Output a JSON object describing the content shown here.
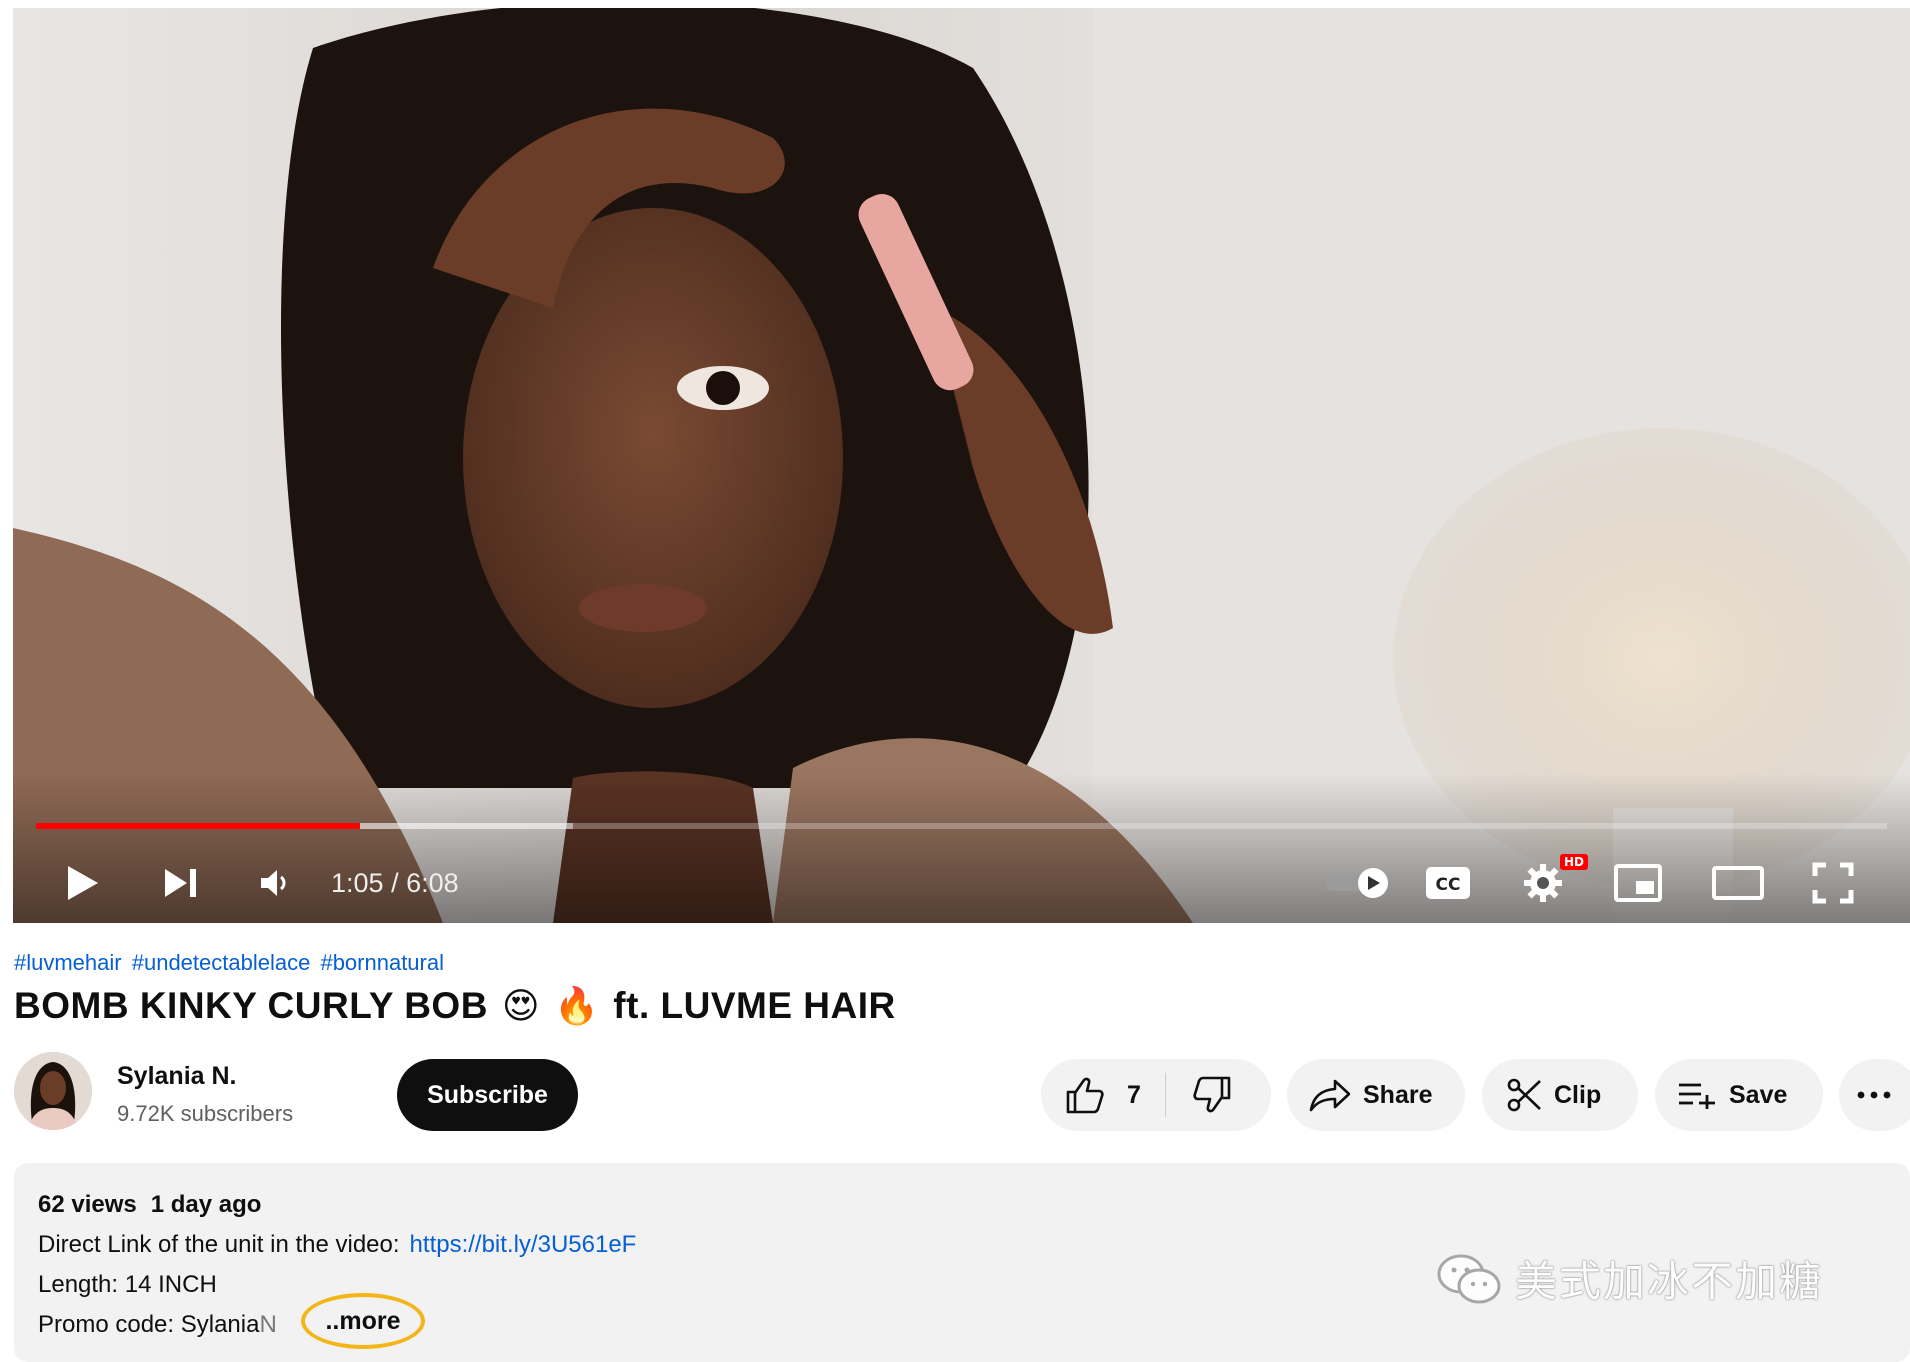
{
  "player": {
    "time_current": "1:05",
    "time_separator": " / ",
    "time_total": "6:08",
    "played_fraction": 0.175,
    "buffered_fraction": 0.29,
    "hd_badge": "HD",
    "icons": [
      "play-icon",
      "next-icon",
      "volume-icon",
      "autoplay-toggle-icon",
      "captions-icon",
      "settings-icon",
      "miniplayer-icon",
      "theater-icon",
      "fullscreen-icon"
    ],
    "progress_color": "#ff0000"
  },
  "video": {
    "hashtags": [
      "#luvmehair",
      "#undetectablelace",
      "#bornnatural"
    ],
    "title_part1": "BOMB KINKY CURLY BOB",
    "title_emoji1": "😍",
    "title_emoji2": "🔥",
    "title_part2": "ft. LUVME HAIR"
  },
  "channel": {
    "name": "Sylania N.",
    "subscribers": "9.72K subscribers",
    "subscribe_label": "Subscribe"
  },
  "actions": {
    "like_count": "7",
    "share_label": "Share",
    "clip_label": "Clip",
    "save_label": "Save",
    "more_icon": "more-horizontal-icon"
  },
  "description": {
    "views": "62 views",
    "date": "1 day ago",
    "link_label": "Direct Link of the unit in the video:",
    "link_url": "https://bit.ly/3U561eF",
    "length_line": "Length: 14 INCH",
    "promo_prefix": "Promo code: Sylania",
    "promo_faded": "N",
    "more_label": "..more",
    "highlight_color": "#f4b519"
  },
  "watermark": {
    "text": "美式加冰不加糖"
  },
  "colors": {
    "link": "#065fd4",
    "pill_bg": "#f2f2f2",
    "subscribe_bg": "#0f0f0f"
  }
}
